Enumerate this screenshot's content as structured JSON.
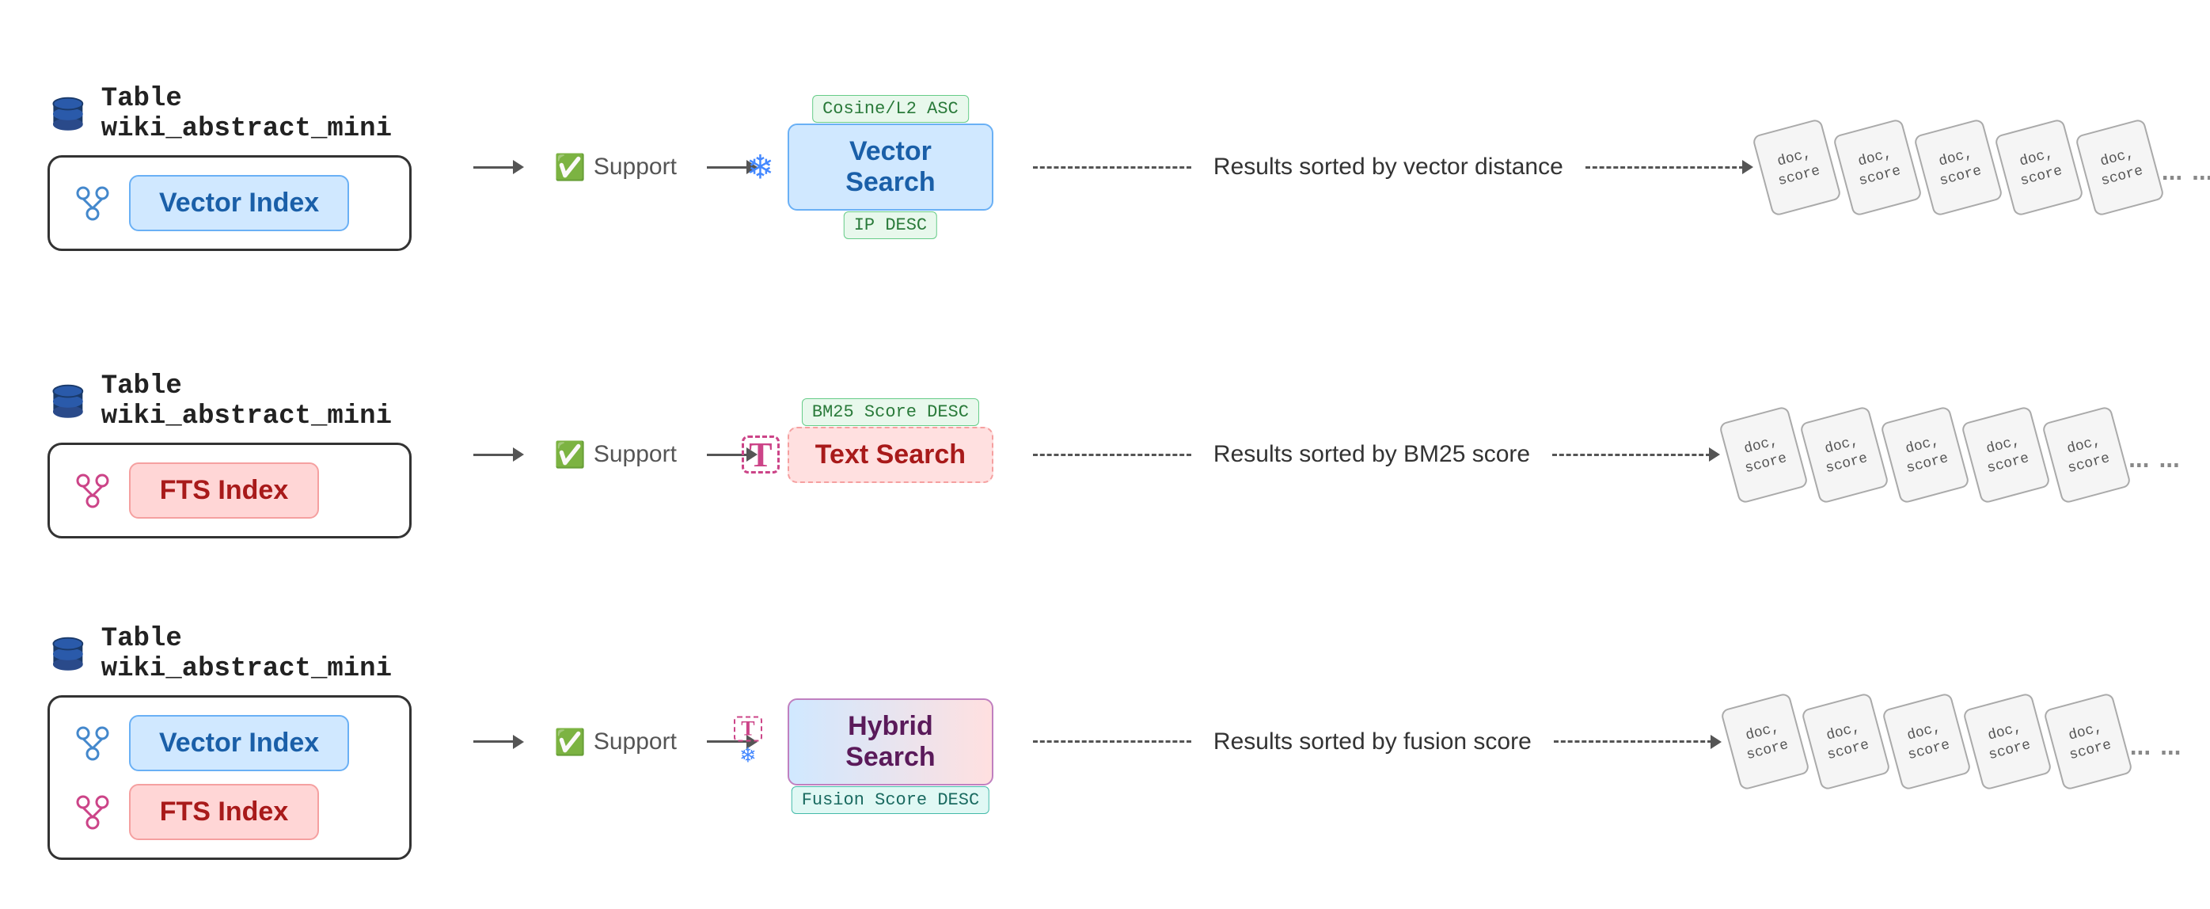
{
  "rows": [
    {
      "id": "vector-row",
      "table_label": "Table wiki_abstract_mini",
      "indices": [
        {
          "type": "vector",
          "label": "Vector Index"
        }
      ],
      "support": "Support",
      "search_type": "vector",
      "search_label": "Vector Search",
      "desc": "Results sorted by vector distance",
      "score_top": "Cosine/L2 ASC",
      "score_bottom": "IP DESC",
      "score_top_color": "green",
      "score_bottom_color": "green"
    },
    {
      "id": "text-row",
      "table_label": "Table wiki_abstract_mini",
      "indices": [
        {
          "type": "fts",
          "label": "FTS Index"
        }
      ],
      "support": "Support",
      "search_type": "text",
      "search_label": "Text Search",
      "desc": "Results sorted by BM25 score",
      "score_top": "BM25 Score DESC",
      "score_top_color": "green",
      "score_bottom": null
    },
    {
      "id": "hybrid-row",
      "table_label": "Table wiki_abstract_mini",
      "indices": [
        {
          "type": "vector",
          "label": "Vector Index"
        },
        {
          "type": "fts",
          "label": "FTS Index"
        }
      ],
      "support": "Support",
      "search_type": "hybrid",
      "search_label": "Hybrid Search",
      "desc": "Results sorted by fusion score",
      "score_top": null,
      "score_bottom": "Fusion Score DESC",
      "score_bottom_color": "teal"
    }
  ],
  "doc_cards": [
    "doc, score",
    "doc, score",
    "doc, score",
    "doc, score",
    "doc, score"
  ],
  "ellipsis": "...",
  "icons": {
    "db": "🗄",
    "branch_blue": "blue-branch",
    "branch_pink": "pink-branch",
    "check": "✅",
    "snowflake": "❄",
    "text_t": "T",
    "dots_ellipsis": "..."
  }
}
